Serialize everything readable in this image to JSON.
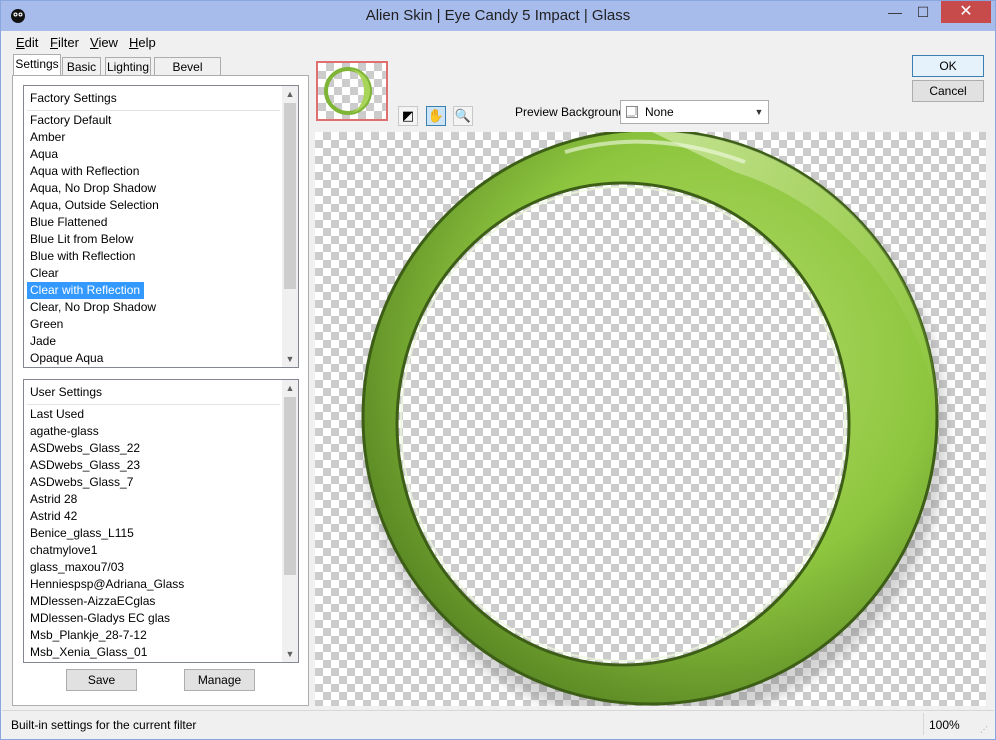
{
  "window": {
    "title": "Alien Skin | Eye Candy 5 Impact | Glass",
    "minimize_glyph": "—",
    "maximize_glyph": "☐",
    "close_glyph": "✕"
  },
  "menu": [
    {
      "label": "Edit"
    },
    {
      "label": "Filter"
    },
    {
      "label": "View"
    },
    {
      "label": "Help"
    }
  ],
  "tabs": [
    {
      "label": "Settings",
      "active": true
    },
    {
      "label": "Basic",
      "active": false
    },
    {
      "label": "Lighting",
      "active": false
    },
    {
      "label": "Bevel Profile",
      "active": false
    }
  ],
  "factory_settings": {
    "header": "Factory Settings",
    "items": [
      "Factory Default",
      "Amber",
      "Aqua",
      "Aqua with Reflection",
      "Aqua, No Drop Shadow",
      "Aqua, Outside Selection",
      "Blue Flattened",
      "Blue Lit from Below",
      "Blue with Reflection",
      "Clear",
      "Clear with Reflection",
      "Clear, No Drop Shadow",
      "Green",
      "Jade",
      "Opaque Aqua"
    ],
    "selected": "Clear with Reflection"
  },
  "user_settings": {
    "header": "User Settings",
    "items": [
      "Last Used",
      "agathe-glass",
      "ASDwebs_Glass_22",
      "ASDwebs_Glass_23",
      "ASDwebs_Glass_7",
      "Astrid 28",
      "Astrid 42",
      "Benice_glass_L115",
      "chatmylove1",
      "glass_maxou7/03",
      "Henniespsp@Adriana_Glass",
      "MDlessen-AizzaECglas",
      "MDlessen-Gladys EC glas",
      "Msb_Plankje_28-7-12",
      "Msb_Xenia_Glass_01"
    ]
  },
  "buttons": {
    "save": "Save",
    "manage": "Manage",
    "ok": "OK",
    "cancel": "Cancel"
  },
  "toolbar": {
    "tools": [
      {
        "icon": "compare-icon",
        "glyph": "◩",
        "active": false
      },
      {
        "icon": "hand-pan-icon",
        "glyph": "✋",
        "active": true
      },
      {
        "icon": "zoom-icon",
        "glyph": "🔍",
        "active": false
      }
    ],
    "preview_background_label": "Preview Background:",
    "preview_background_value": "None"
  },
  "status": {
    "text": "Built-in settings for the current filter",
    "zoom": "100%"
  },
  "colors": {
    "selection": "#3399ff",
    "glass_green": "#8ec63f",
    "glass_dark": "#4f7a1e",
    "title_bar": "#a8bcec",
    "close_button": "#c74b4b"
  }
}
